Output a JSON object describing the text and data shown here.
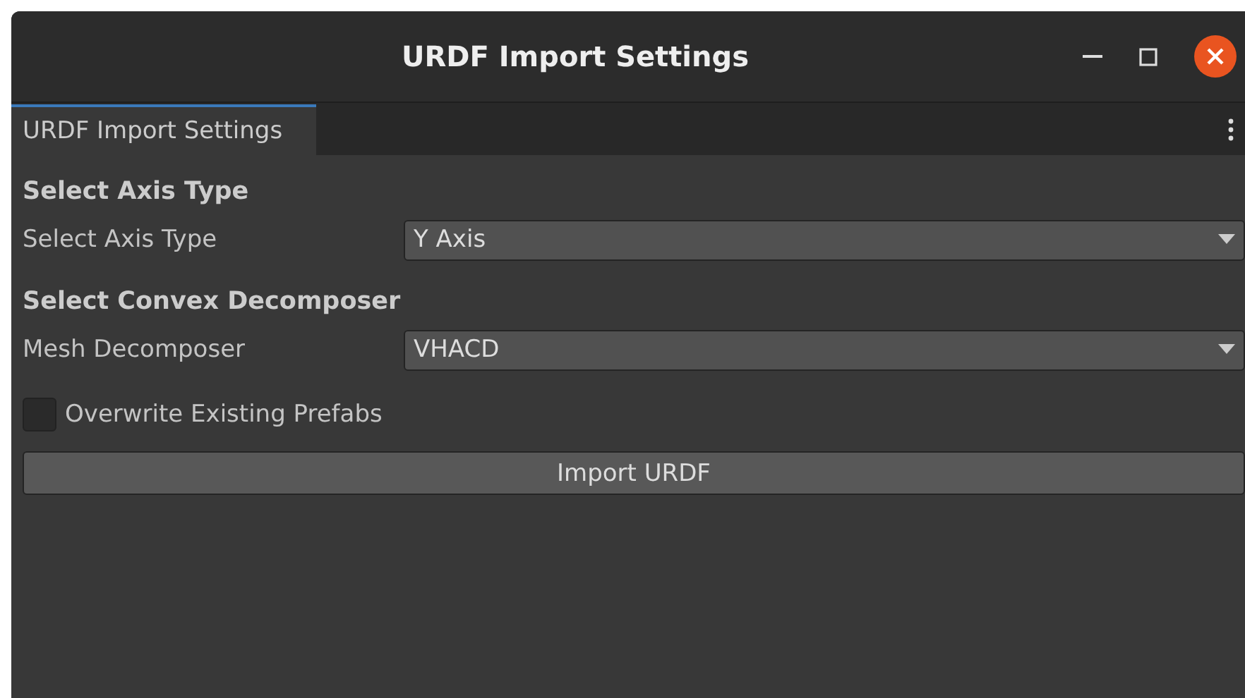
{
  "window": {
    "title": "URDF Import Settings"
  },
  "tabs": [
    {
      "label": "URDF Import Settings",
      "selected": true
    }
  ],
  "items": [
    {
      "kind": "header",
      "label": "Select Axis Type"
    },
    {
      "kind": "dropdown",
      "label": "Select Axis Type",
      "value": "Y Axis"
    },
    {
      "kind": "header",
      "label": "Select Convex Decomposer"
    },
    {
      "kind": "dropdown",
      "label": "Mesh Decomposer",
      "value": "VHACD"
    },
    {
      "kind": "checkbox",
      "label": "Overwrite Existing Prefabs",
      "checked": false
    },
    {
      "kind": "button",
      "label": "Import URDF"
    }
  ]
}
